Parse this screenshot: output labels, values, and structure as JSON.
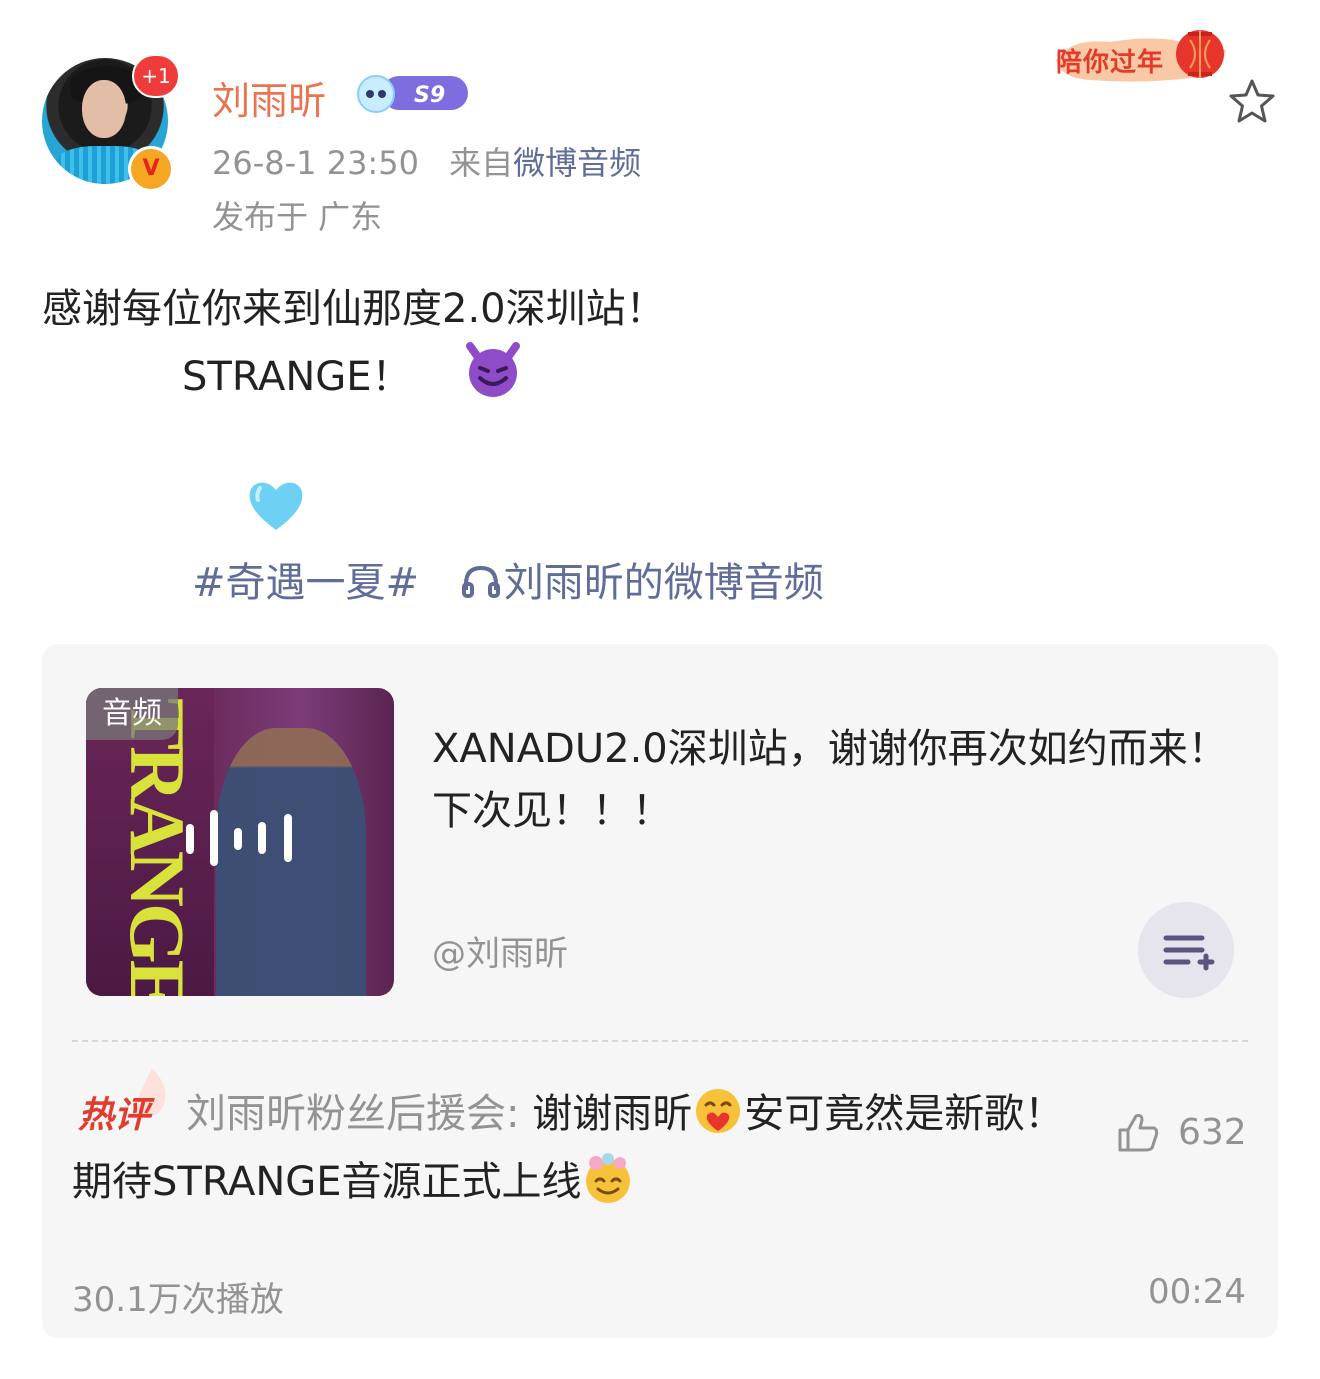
{
  "header": {
    "notification_badge": "+1",
    "username": "刘雨昕",
    "level": "S9",
    "timestamp": "26-8-1 23:50",
    "source_prefix": "来自",
    "source": "微博音频",
    "location": "发布于 广东",
    "banner_text": "陪你过年"
  },
  "post": {
    "line1": "感谢每位你来到仙那度2.0深圳站！",
    "line2": "STRANGE！",
    "emoji_devil": "smiling-devil-emoji",
    "emoji_heart": "light-blue-heart-emoji",
    "hashtag": "#奇遇一夏#",
    "audio_link": "刘雨昕的微博音频"
  },
  "card": {
    "tag": "音频",
    "title": "XANADU2.0深圳站，谢谢你再次如约而来！下次见！！！",
    "author": "@刘雨昕",
    "hot_label": "热评",
    "comment_user": "刘雨昕粉丝后援会:",
    "comment_part1": " 谢谢雨昕",
    "comment_part2": "安可竟然是新歌！期待STRANGE音源正式上线",
    "likes": "632",
    "plays": "30.1万次播放",
    "duration": "00:24"
  },
  "colors": {
    "username": "#eb7350",
    "link": "#5f6d98",
    "meta": "#939393",
    "hot": "#e03d2f"
  }
}
